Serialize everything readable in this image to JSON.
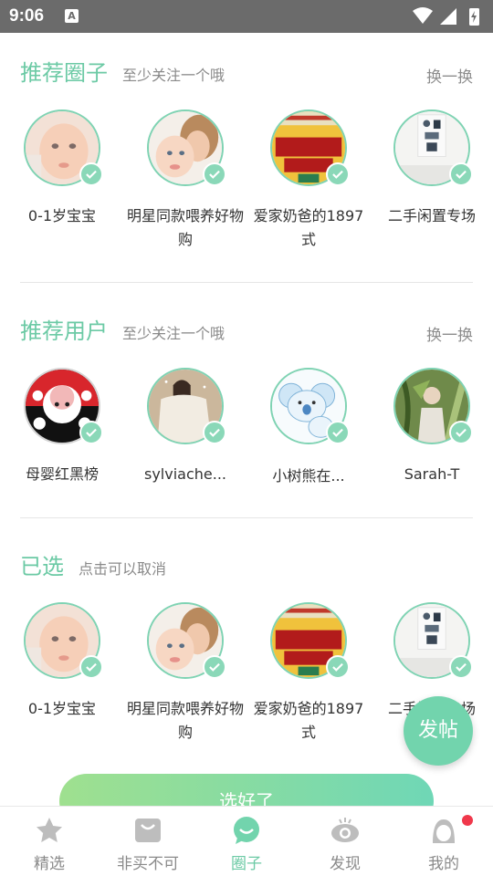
{
  "status_bar": {
    "time": "9:06",
    "notification_icon": "A"
  },
  "recommended_circles": {
    "title": "推荐圈子",
    "subtitle": "至少关注一个哦",
    "swap": "换一换",
    "items": [
      {
        "label": "0-1岁宝宝",
        "icon": "baby-photo"
      },
      {
        "label": "明星同款喂养好物购",
        "icon": "mother-baby-photo"
      },
      {
        "label": "爱家奶爸的1897式",
        "icon": "poster-photo"
      },
      {
        "label": "二手闲置专场",
        "icon": "room-photo"
      }
    ]
  },
  "recommended_users": {
    "title": "推荐用户",
    "subtitle": "至少关注一个哦",
    "swap": "换一换",
    "items": [
      {
        "label": "母婴红黑榜",
        "icon": "cartoon-face-avatar"
      },
      {
        "label": "sylviache...",
        "icon": "woman-blanket-photo"
      },
      {
        "label": "小树熊在...",
        "icon": "koala-cartoon-avatar"
      },
      {
        "label": "Sarah-T",
        "icon": "plant-photo"
      }
    ]
  },
  "selected": {
    "title": "已选",
    "subtitle": "点击可以取消",
    "items": [
      {
        "label": "0-1岁宝宝",
        "icon": "baby-photo"
      },
      {
        "label": "明星同款喂养好物购",
        "icon": "mother-baby-photo"
      },
      {
        "label": "爱家奶爸的1897式",
        "icon": "poster-photo"
      },
      {
        "label": "二手闲置专场",
        "icon": "room-photo"
      }
    ]
  },
  "done_button": "选好了",
  "fab": "发帖",
  "tabbar": {
    "tabs": [
      {
        "label": "精选",
        "icon": "star-icon"
      },
      {
        "label": "非买不可",
        "icon": "bag-icon"
      },
      {
        "label": "圈子",
        "icon": "chat-bubble-icon",
        "active": true
      },
      {
        "label": "发现",
        "icon": "eye-icon"
      },
      {
        "label": "我的",
        "icon": "profile-icon",
        "badge": true
      }
    ]
  },
  "colors": {
    "accent": "#6ccaa5",
    "check": "#8ad8b8",
    "badge": "#f0384b"
  }
}
